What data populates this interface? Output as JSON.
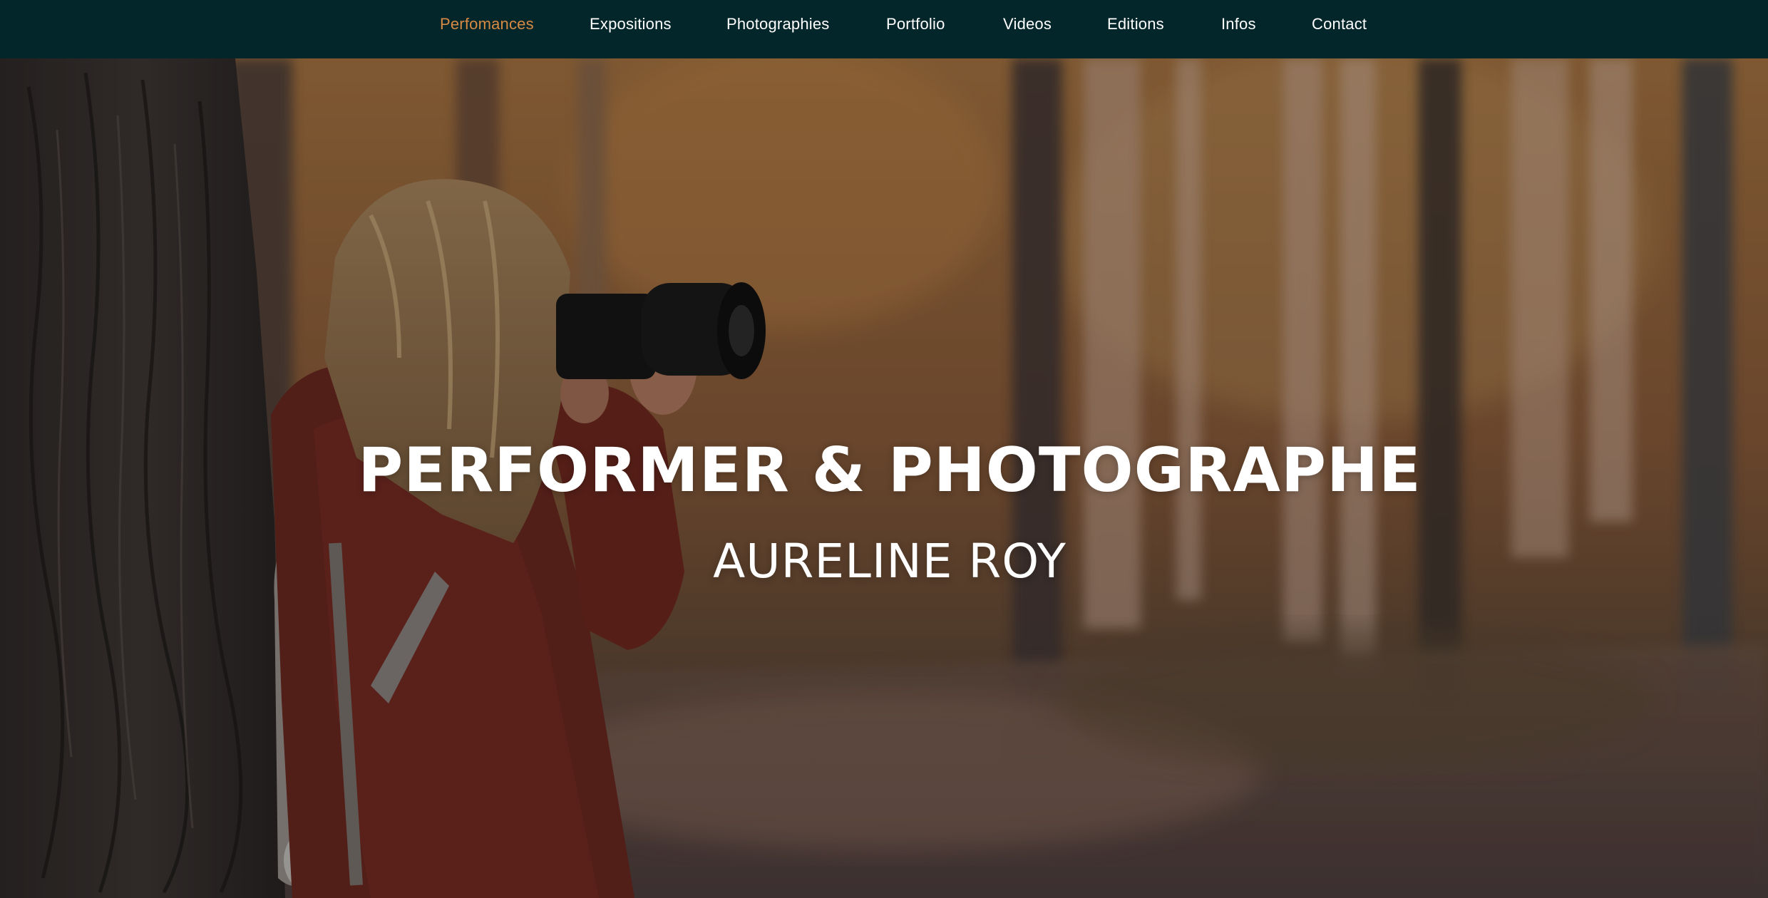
{
  "nav": {
    "items": [
      {
        "label": "Perfomances",
        "active": true
      },
      {
        "label": "Expositions",
        "active": false
      },
      {
        "label": "Photographies",
        "active": false
      },
      {
        "label": "Portfolio",
        "active": false
      },
      {
        "label": "Videos",
        "active": false
      },
      {
        "label": "Editions",
        "active": false
      },
      {
        "label": "Infos",
        "active": false
      },
      {
        "label": "Contact",
        "active": false
      }
    ]
  },
  "hero": {
    "headline": "PERFORMER & PHOTOGRAPHE",
    "subtitle": "AURELINE ROY",
    "image": "woman-photographer-in-autumn-forest"
  },
  "colors": {
    "nav_background": "#03262a",
    "nav_active": "#d68a43",
    "nav_text": "#ffffff",
    "hero_text": "#ffffff"
  }
}
